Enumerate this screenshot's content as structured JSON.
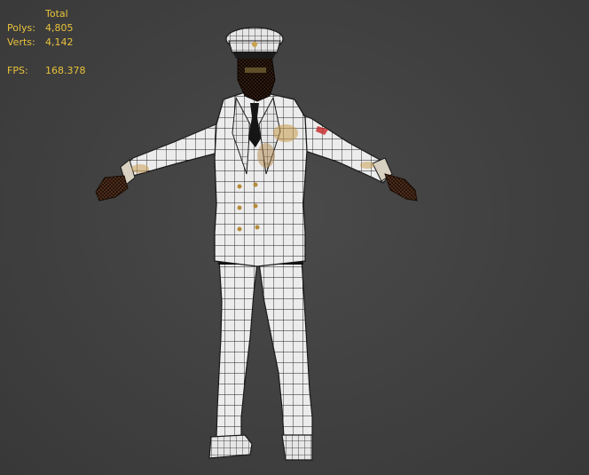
{
  "stats": {
    "header": "Total",
    "polys_label": "Polys:",
    "polys_value": "4,805",
    "verts_label": "Verts:",
    "verts_value": "4,142",
    "fps_label": "FPS:",
    "fps_value": "168.378"
  },
  "colors": {
    "stats_text": "#e8c23a",
    "viewport_bg": "#404040",
    "uniform": "#ededed",
    "wire": "#1a1a1a"
  },
  "icons": {
    "model": "sailor-character-wireframe-model"
  }
}
